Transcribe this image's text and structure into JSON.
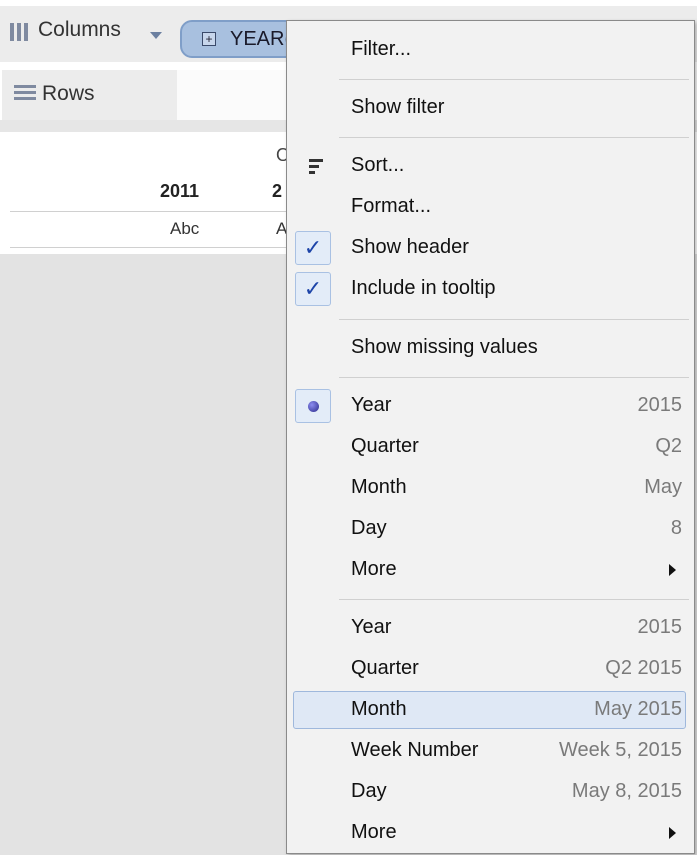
{
  "shelves": {
    "columns_label": "Columns",
    "rows_label": "Rows",
    "pill_label": "YEAR("
  },
  "view": {
    "header_top_partial": "O",
    "col_header_1": "2011",
    "col_header_2_partial": "2",
    "cell_1": "Abc",
    "cell_2_partial": "A"
  },
  "menu": {
    "filter": "Filter...",
    "show_filter": "Show filter",
    "sort": "Sort...",
    "format": "Format...",
    "show_header": "Show header",
    "include_in_tooltip": "Include in tooltip",
    "show_missing_values": "Show missing values",
    "discrete": [
      {
        "label": "Year",
        "value": "2015"
      },
      {
        "label": "Quarter",
        "value": "Q2"
      },
      {
        "label": "Month",
        "value": "May"
      },
      {
        "label": "Day",
        "value": "8"
      },
      {
        "label": "More",
        "value": ""
      }
    ],
    "continuous": [
      {
        "label": "Year",
        "value": "2015"
      },
      {
        "label": "Quarter",
        "value": "Q2 2015"
      },
      {
        "label": "Month",
        "value": "May 2015"
      },
      {
        "label": "Week Number",
        "value": "Week 5, 2015"
      },
      {
        "label": "Day",
        "value": "May 8, 2015"
      },
      {
        "label": "More",
        "value": ""
      }
    ],
    "check_glyph": "✓"
  },
  "colors": {
    "pill_bg": "#a8c0df",
    "highlight_bg": "#dfe8f5",
    "check_color": "#1d44a8"
  }
}
